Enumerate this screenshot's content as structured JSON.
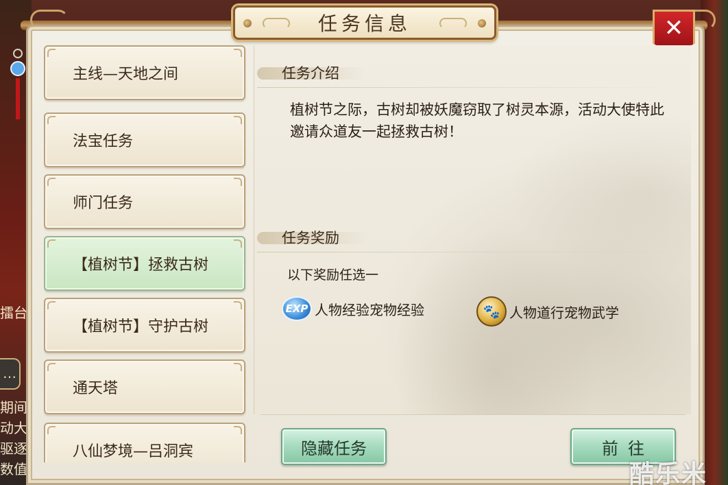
{
  "window": {
    "title": "任务信息",
    "close_label": "✕"
  },
  "background": {
    "side_text_1": "擂台",
    "side_text_2": "期间",
    "side_text_3": "动大",
    "side_text_4": "驱逐",
    "side_text_5": "数值",
    "chat_icon": "…"
  },
  "task_list": {
    "items": [
      {
        "label": "主线—天地之间",
        "selected": false
      },
      {
        "label": "法宝任务",
        "selected": false
      },
      {
        "label": "师门任务",
        "selected": false
      },
      {
        "label": "【植树节】拯救古树",
        "selected": true
      },
      {
        "label": "【植树节】守护古树",
        "selected": false
      },
      {
        "label": "通天塔",
        "selected": false
      },
      {
        "label": "八仙梦境—吕洞宾",
        "selected": false
      }
    ]
  },
  "detail": {
    "intro_header": "任务介绍",
    "intro_text": "植树节之际，古树却被妖魔窃取了树灵本源，活动大使特此邀请众道友一起拯救古树！",
    "reward_header": "任务奖励",
    "reward_note": "以下奖励任选一",
    "rewards": [
      {
        "icon": "exp-icon",
        "icon_text": "EXP",
        "label": "人物经验宠物经验"
      },
      {
        "icon": "paw-coin-icon",
        "icon_text": "🐾",
        "label": "人物道行宠物武学"
      }
    ]
  },
  "buttons": {
    "hide_label": "隐藏任务",
    "go_label": "前往"
  },
  "watermark": "酷乐米",
  "colors": {
    "panel_bg": "#f2efe6",
    "selected_item": "#c9e6c2",
    "button_green": "#a9dcc0",
    "close_red": "#c41e22"
  }
}
